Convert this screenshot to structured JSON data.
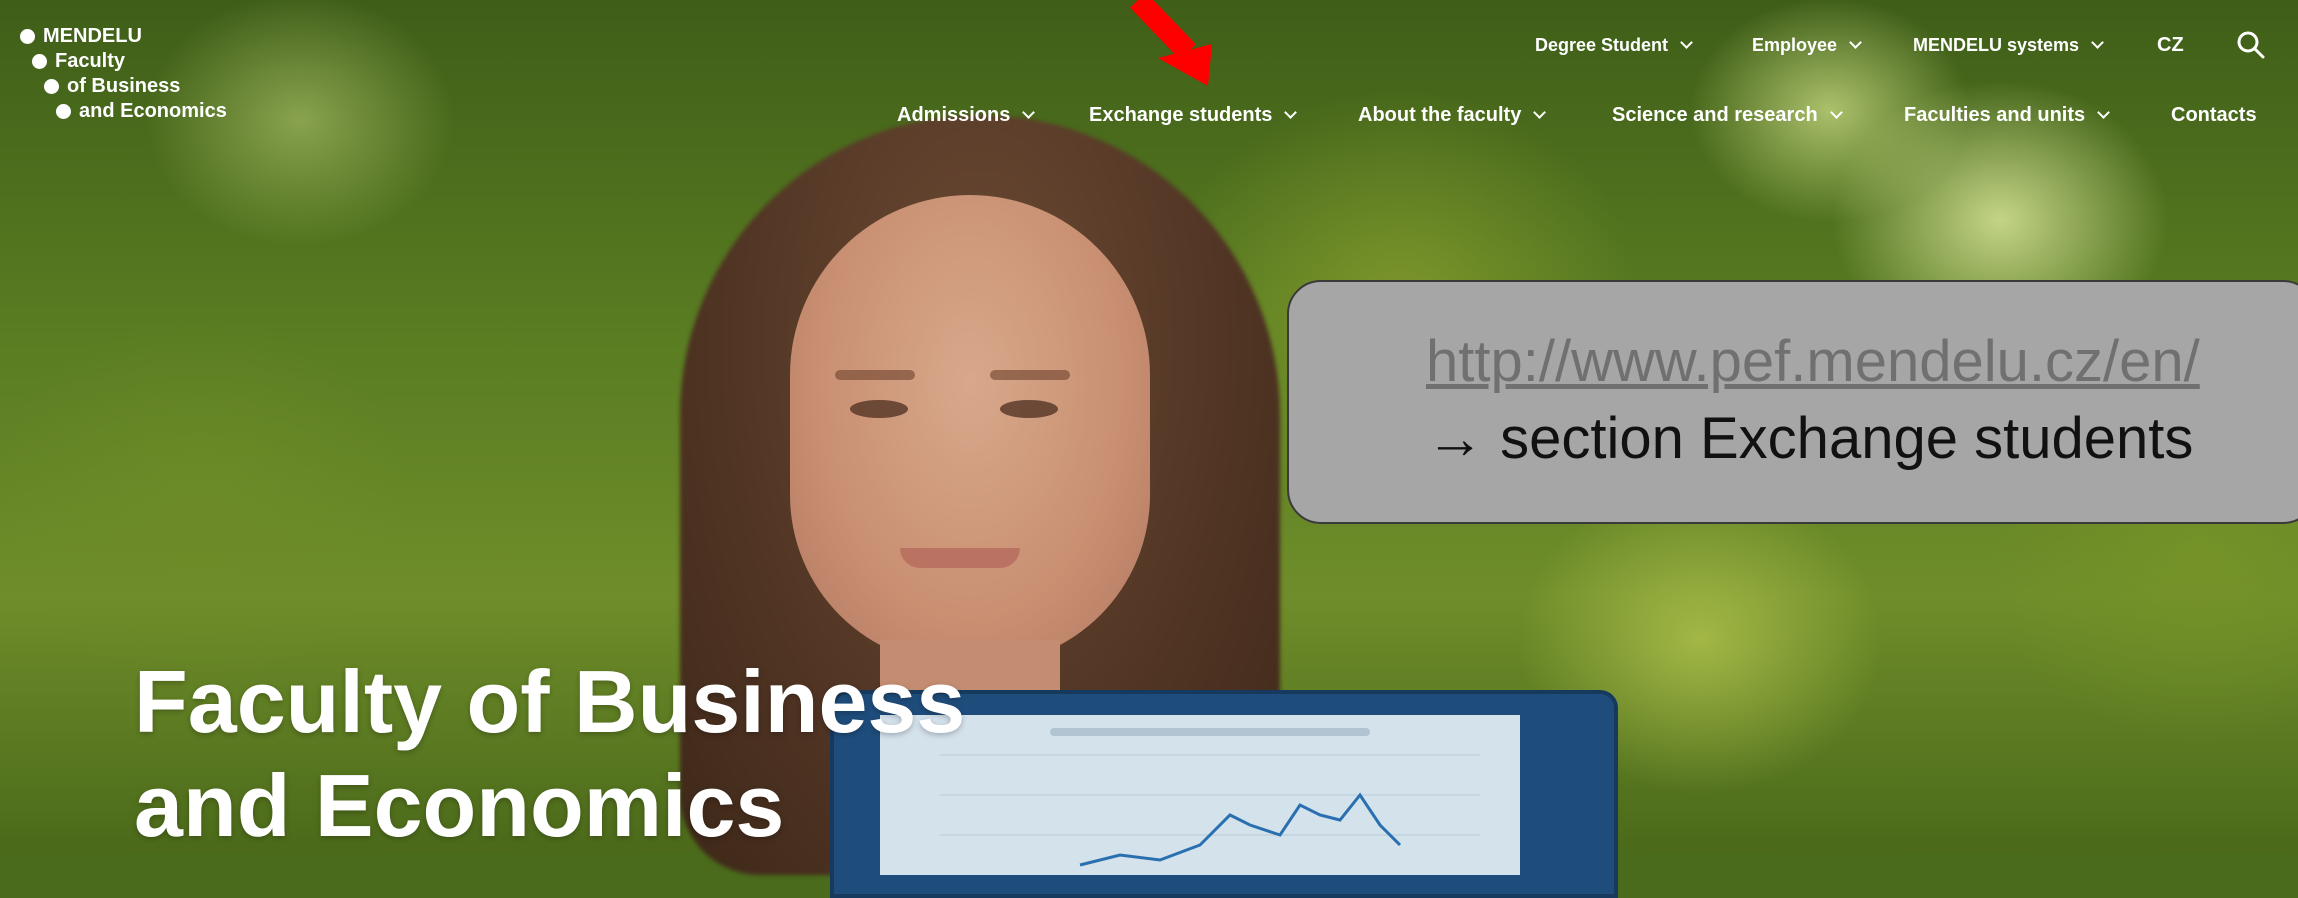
{
  "logo": {
    "lines": [
      "MENDELU",
      "Faculty",
      "of Business",
      "and Economics"
    ]
  },
  "top_nav": {
    "items": [
      {
        "label": "Degree Student"
      },
      {
        "label": "Employee"
      },
      {
        "label": "MENDELU systems"
      }
    ],
    "lang": "CZ",
    "search_icon": "search-icon"
  },
  "main_nav": {
    "items": [
      {
        "label": "Admissions"
      },
      {
        "label": "Exchange students"
      },
      {
        "label": "About the faculty"
      },
      {
        "label": "Science and research"
      },
      {
        "label": "Faculties and units"
      },
      {
        "label": "Contacts"
      }
    ]
  },
  "callout": {
    "url": "http://www.pef.mendelu.cz/en/",
    "text": "→ section Exchange students"
  },
  "hero": {
    "title_line1": "Faculty of Business",
    "title_line2": "and Economics"
  },
  "colors": {
    "arrow": "#ff0000",
    "callout_bg": "#a6a6a6",
    "nav_text": "#ffffff"
  }
}
